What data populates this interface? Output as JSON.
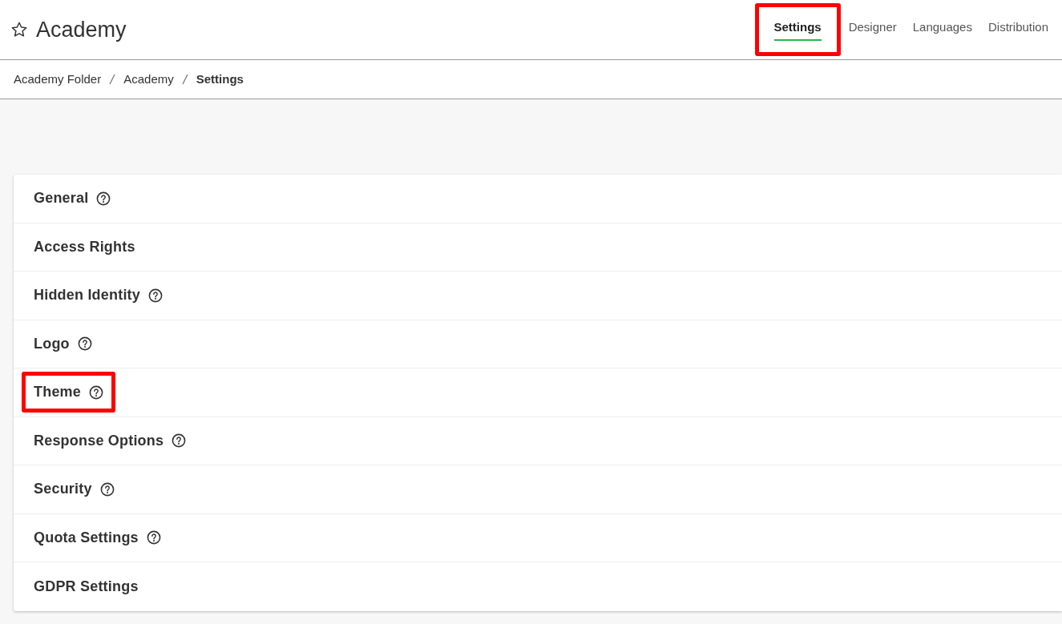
{
  "header": {
    "title": "Academy",
    "favorite": false
  },
  "tabs": [
    {
      "label": "Settings",
      "selected": true,
      "highlighted": true
    },
    {
      "label": "Designer",
      "selected": false,
      "highlighted": false
    },
    {
      "label": "Languages",
      "selected": false,
      "highlighted": false
    },
    {
      "label": "Distribution",
      "selected": false,
      "highlighted": false
    }
  ],
  "breadcrumb": [
    {
      "label": "Academy Folder",
      "current": false
    },
    {
      "label": "Academy",
      "current": false
    },
    {
      "label": "Settings",
      "current": true
    }
  ],
  "sections": [
    {
      "label": "General",
      "help": true,
      "highlighted": false
    },
    {
      "label": "Access Rights",
      "help": false,
      "highlighted": false
    },
    {
      "label": "Hidden Identity",
      "help": true,
      "highlighted": false
    },
    {
      "label": "Logo",
      "help": true,
      "highlighted": false
    },
    {
      "label": "Theme",
      "help": true,
      "highlighted": true
    },
    {
      "label": "Response Options",
      "help": true,
      "highlighted": false
    },
    {
      "label": "Security",
      "help": true,
      "highlighted": false
    },
    {
      "label": "Quota Settings",
      "help": true,
      "highlighted": false
    },
    {
      "label": "GDPR Settings",
      "help": false,
      "highlighted": false
    }
  ]
}
